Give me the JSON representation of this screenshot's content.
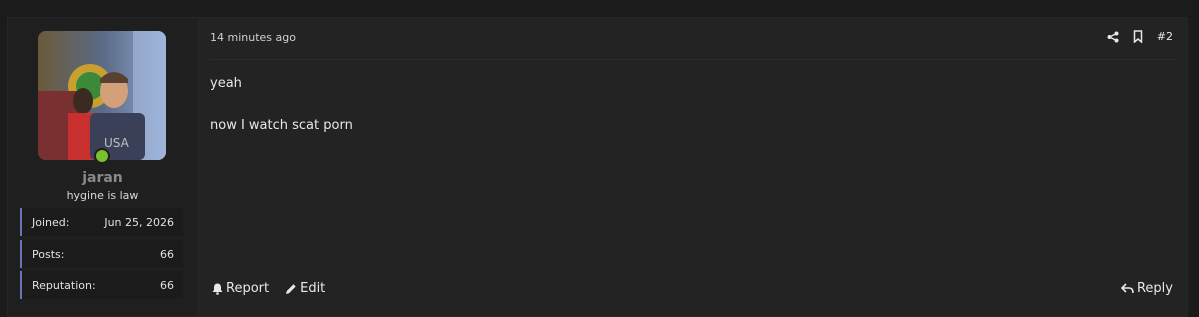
{
  "post": {
    "user": {
      "username": "jaran",
      "user_title": "hygine is law",
      "avatar": "avatar-photo",
      "online": true,
      "online_color": "#78c12a",
      "stats": [
        {
          "label": "Joined:",
          "value": "Jun 25, 2026"
        },
        {
          "label": "Posts:",
          "value": "66"
        },
        {
          "label": "Reputation:",
          "value": "66"
        }
      ],
      "accent_color": "#6a74b8"
    },
    "timestamp": "14 minutes ago",
    "post_number": "#2",
    "icons": {
      "share": "share-icon",
      "bookmark": "bookmark-icon"
    },
    "body": [
      "yeah",
      "now I watch scat porn"
    ],
    "actions": {
      "report": "Report",
      "edit": "Edit",
      "reply": "Reply"
    }
  }
}
